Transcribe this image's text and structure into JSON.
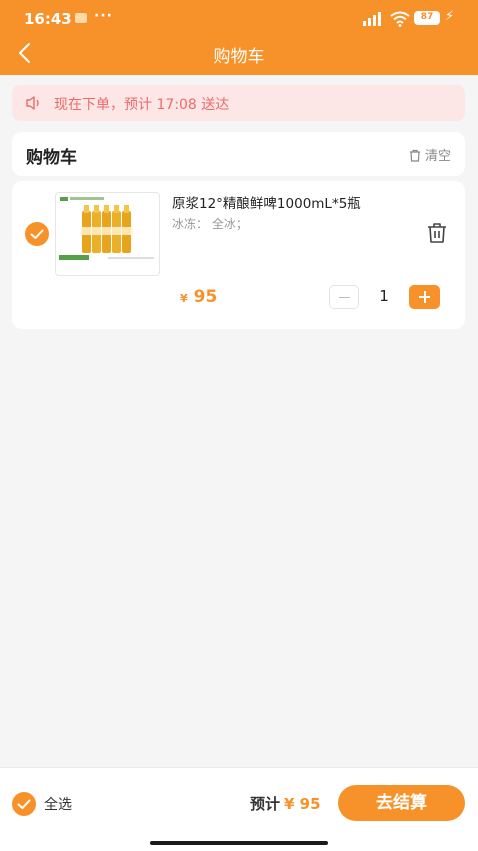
{
  "status_bar": {
    "time": "16:43",
    "dots": "···",
    "battery": "87"
  },
  "nav": {
    "title": "购物车"
  },
  "notice": {
    "text": "现在下单，预计 17:08 送达"
  },
  "cart_header": {
    "title": "购物车",
    "clear_label": "清空"
  },
  "items": [
    {
      "name": "原浆12°精酿鲜啤1000mL*5瓶",
      "spec": "冰冻： 全冰；",
      "currency": "¥",
      "price": "95",
      "quantity": "1",
      "checked": true
    }
  ],
  "footer": {
    "select_all_label": "全选",
    "total_label": "预计",
    "total_amount": "¥ 95",
    "checkout_label": "去结算"
  },
  "colors": {
    "accent": "#f7922a",
    "notice_bg": "#fde7e6",
    "notice_text": "#ef6a6a"
  },
  "icons": [
    "message-icon",
    "signal-icon",
    "wifi-icon",
    "bolt-icon",
    "back-arrow-icon",
    "speaker-icon",
    "trash-icon",
    "checkmark-icon",
    "minus-icon",
    "plus-icon"
  ]
}
